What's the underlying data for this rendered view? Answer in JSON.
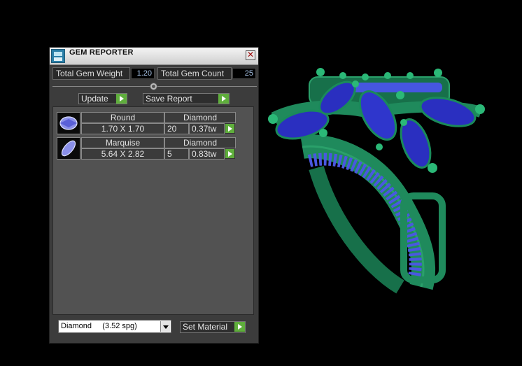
{
  "panel": {
    "title": "GEM REPORTER",
    "close_glyph": "✕",
    "total_weight_label": "Total Gem Weight",
    "total_weight_value": "1.20",
    "total_count_label": "Total Gem Count",
    "total_count_value": "25",
    "update_label": "Update",
    "save_label": "Save Report",
    "gems": [
      {
        "shape": "Round",
        "material": "Diamond",
        "size": "1.70 X 1.70",
        "count": "20",
        "weight": "0.37tw",
        "icon": "round-gem-icon"
      },
      {
        "shape": "Marquise",
        "material": "Diamond",
        "size": "5.64 X 2.82",
        "count": "5",
        "weight": "0.83tw",
        "icon": "marquise-gem-icon"
      }
    ],
    "material_select": "Diamond     (3.52 spg)",
    "set_material_label": "Set Material"
  },
  "colors": {
    "panel_bg": "#3c3c3c",
    "accent_green": "#5fae3c",
    "value_blue": "#a9c6ea",
    "ring_metal": "#1f8a5c",
    "gem_blue": "#2a2fc0"
  }
}
